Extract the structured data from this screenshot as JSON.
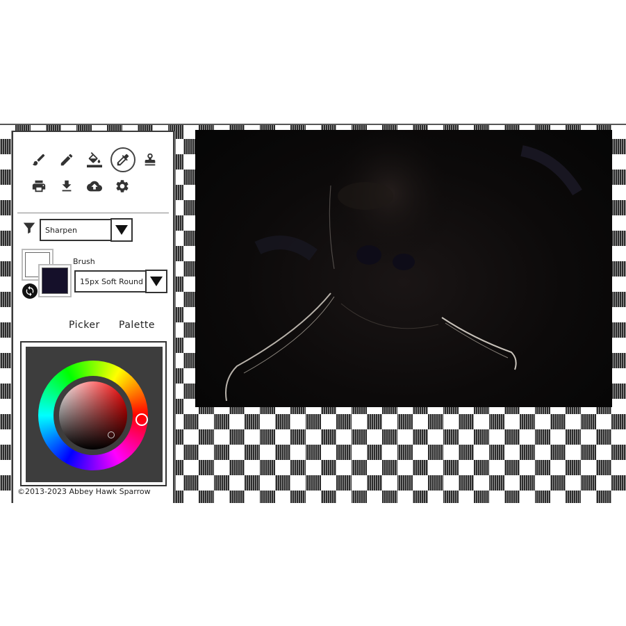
{
  "toolbar": {
    "row1": [
      {
        "icon": "brush-icon",
        "active": false
      },
      {
        "icon": "pencil-icon",
        "active": false
      },
      {
        "icon": "paint-bucket-icon",
        "active": false
      },
      {
        "icon": "eyedropper-icon",
        "active": true
      },
      {
        "icon": "stamp-icon",
        "active": false
      }
    ],
    "row2": [
      {
        "icon": "print-icon"
      },
      {
        "icon": "download-icon"
      },
      {
        "icon": "cloud-upload-icon"
      },
      {
        "icon": "gear-icon"
      }
    ]
  },
  "filter": {
    "icon": "filter-icon",
    "selected": "Sharpen"
  },
  "brush": {
    "label": "Brush",
    "selected": "15px Soft Round"
  },
  "colors": {
    "secondary": "#ffffff",
    "primary": "#15102a",
    "swap_icon": "swap-colors-icon"
  },
  "tabs": {
    "picker": "Picker",
    "palette": "Palette"
  },
  "color_picker": {
    "hue": "#ff0000",
    "background": "#3d3d3d"
  },
  "footer": {
    "copyright": "©2013-2023 Abbey Hawk Sparrow"
  }
}
